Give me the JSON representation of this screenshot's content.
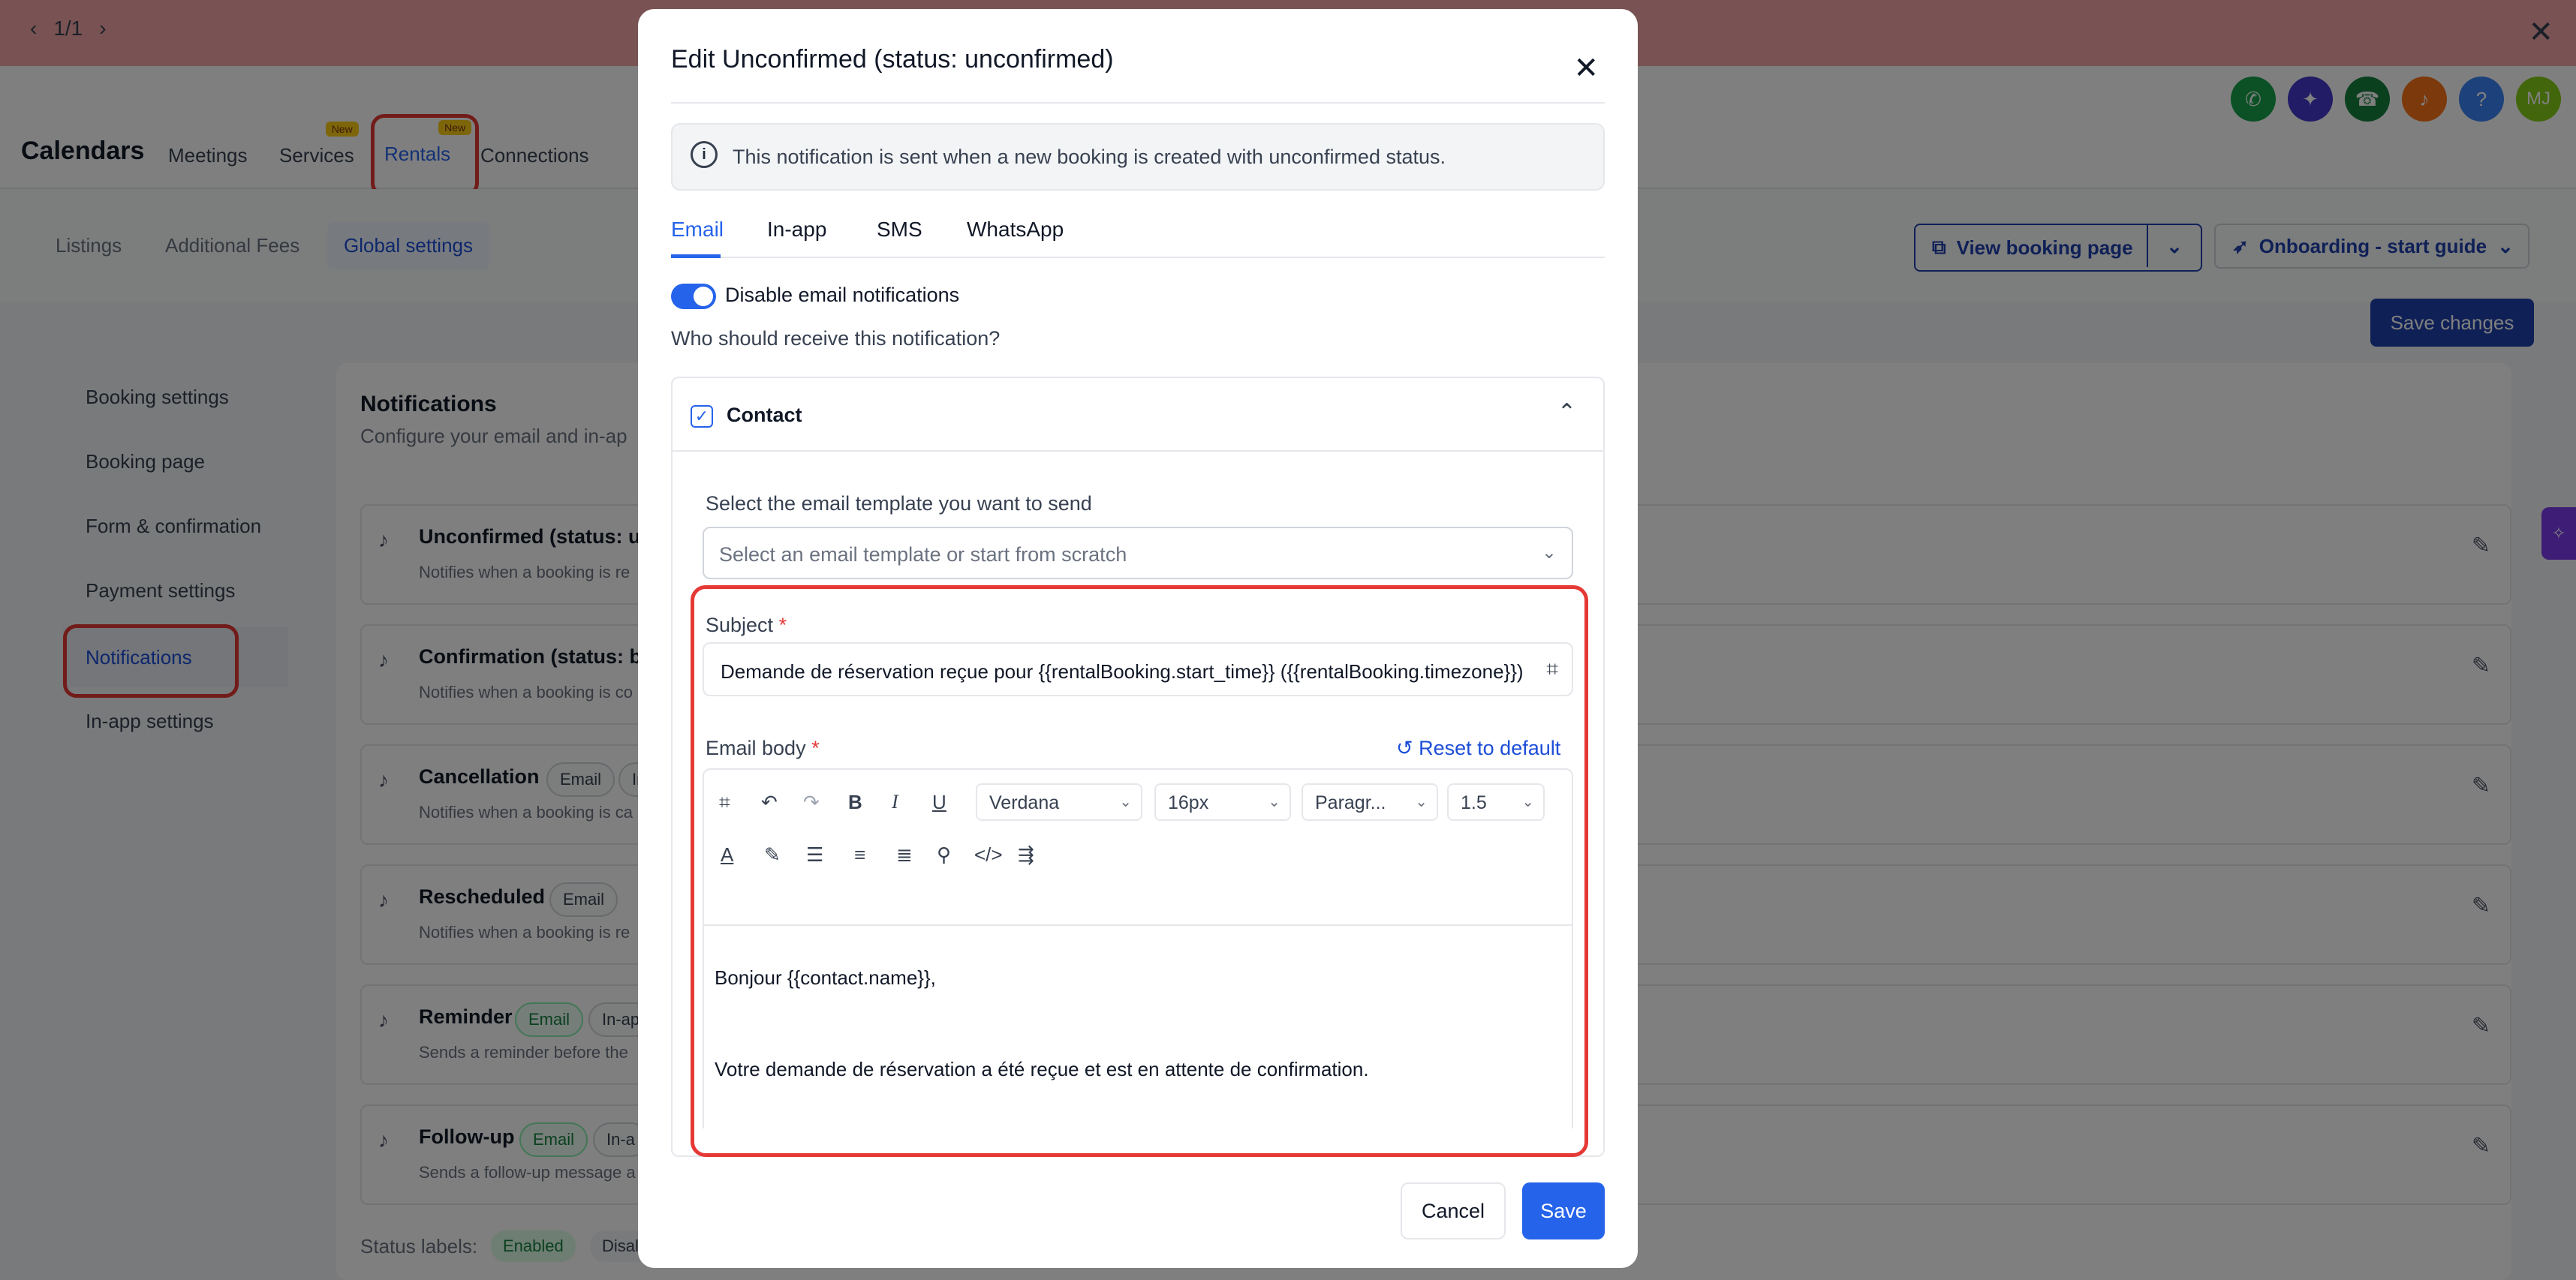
{
  "pager": {
    "prev": "‹",
    "label": "1/1",
    "next": "›",
    "close": "✕"
  },
  "header": {
    "brand": "Calendars",
    "tabs": [
      {
        "label": "Meetings"
      },
      {
        "label": "Services",
        "badge": "New"
      },
      {
        "label": "Rentals",
        "badge": "New"
      },
      {
        "label": "Connections"
      }
    ],
    "avatar": "MJ",
    "icons": [
      "phone-icon",
      "sparkle-icon",
      "megaphone-icon",
      "bell-icon",
      "help-icon"
    ]
  },
  "subnav": {
    "tabs": [
      {
        "label": "Listings"
      },
      {
        "label": "Additional Fees"
      },
      {
        "label": "Global settings"
      }
    ],
    "view_booking": "View booking page",
    "onboarding": "Onboarding - start guide",
    "save_changes": "Save changes"
  },
  "sidenav": {
    "items": [
      {
        "label": "Booking settings"
      },
      {
        "label": "Booking page"
      },
      {
        "label": "Form & confirmation"
      },
      {
        "label": "Payment settings"
      },
      {
        "label": "Notifications"
      },
      {
        "label": "In-app settings"
      }
    ]
  },
  "notifications": {
    "title": "Notifications",
    "subtitle": "Configure your email and in-ap",
    "rows": [
      {
        "title": "Unconfirmed (status: un",
        "desc": "Notifies when a booking is re"
      },
      {
        "title": "Confirmation (status: bo",
        "desc": "Notifies when a booking is co"
      },
      {
        "title": "Cancellation",
        "desc": "Notifies when a booking is ca",
        "chips": [
          "Email",
          "In"
        ]
      },
      {
        "title": "Rescheduled",
        "desc": "Notifies when a booking is re",
        "chips": [
          "Email"
        ]
      },
      {
        "title": "Reminder",
        "desc": "Sends a reminder before the",
        "chips": [
          "Email",
          "In-ap"
        ]
      },
      {
        "title": "Follow-up",
        "desc": "Sends a follow-up message a",
        "chips": [
          "Email",
          "In-a"
        ]
      }
    ],
    "status_labels": "Status labels:",
    "status_enabled": "Enabled",
    "status_disabled": "Disal"
  },
  "modal": {
    "title": "Edit Unconfirmed (status: unconfirmed)",
    "info": "This notification is sent when a new booking is created with unconfirmed status.",
    "channels": [
      {
        "label": "Email"
      },
      {
        "label": "In-app"
      },
      {
        "label": "SMS"
      },
      {
        "label": "WhatsApp"
      }
    ],
    "toggle_label": "Disable email notifications",
    "who_label": "Who should receive this notification?",
    "recipient": "Contact",
    "template_label": "Select the email template you want to send",
    "template_placeholder": "Select an email template or start from scratch",
    "subject_label": "Subject",
    "subject_value": "Demande de réservation reçue pour {{rentalBooking.start_time}} ({{rentalBooking.timezone}})",
    "body_label": "Email body",
    "reset": "Reset to default",
    "toolbar": {
      "font": "Verdana",
      "size": "16px",
      "block": "Paragr...",
      "line_height": "1.5"
    },
    "body_lines": [
      "Bonjour {{contact.name}},",
      "Votre demande de réservation a été reçue et est en attente de confirmation."
    ],
    "cancel": "Cancel",
    "save": "Save"
  },
  "colors": {
    "accent": "#2563eb",
    "highlight": "#e53935",
    "topbar": "#f2a7a7"
  }
}
